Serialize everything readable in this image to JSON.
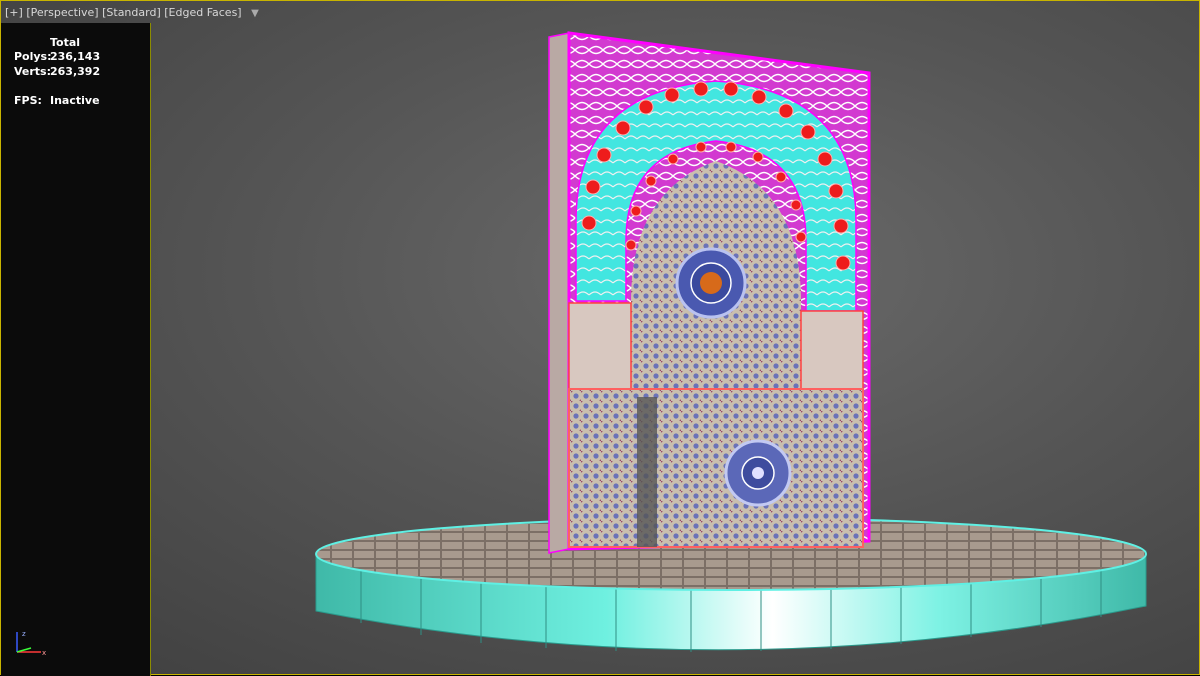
{
  "viewport_label": {
    "plus": "[+]",
    "view": "[Perspective]",
    "shading": "[Standard]",
    "edges": "[Edged Faces]"
  },
  "stats": {
    "header": "Total",
    "polys_label": "Polys:",
    "polys_value": "236,143",
    "verts_label": "Verts:",
    "verts_value": "263,392",
    "fps_label": "FPS:",
    "fps_value": "Inactive"
  },
  "icons": {
    "filter": "funnel-icon",
    "axis": "axis-tripod-icon"
  },
  "colors": {
    "viewport_border": "#c8b400",
    "selection_magenta": "#ff00ff",
    "selection_cyan": "#40e8e0",
    "accent_red": "#ff2020"
  }
}
